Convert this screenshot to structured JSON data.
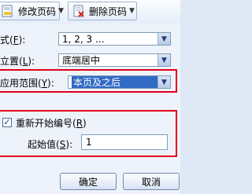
{
  "toolbar": {
    "modify_label": "修改页码",
    "delete_label": "删除页码"
  },
  "form": {
    "style_label": "式(",
    "style_key": "F",
    "style_value": "1, 2, 3 ...",
    "position_label": "立置(",
    "position_key": "L",
    "position_value": "底端居中",
    "range_label": "应用范围(",
    "range_key": "Y",
    "range_value": "本页及之后",
    "restart_label": "重新开始编号(",
    "restart_key": "R",
    "start_label": "起始值(",
    "start_key": "S",
    "start_value": "1"
  },
  "buttons": {
    "ok": "确定",
    "cancel": "取消"
  },
  "colors": {
    "highlight": "#e0001a",
    "selection": "#316ac5"
  },
  "icons": {
    "modify": "page-number-icon",
    "delete": "delete-page-number-icon"
  }
}
